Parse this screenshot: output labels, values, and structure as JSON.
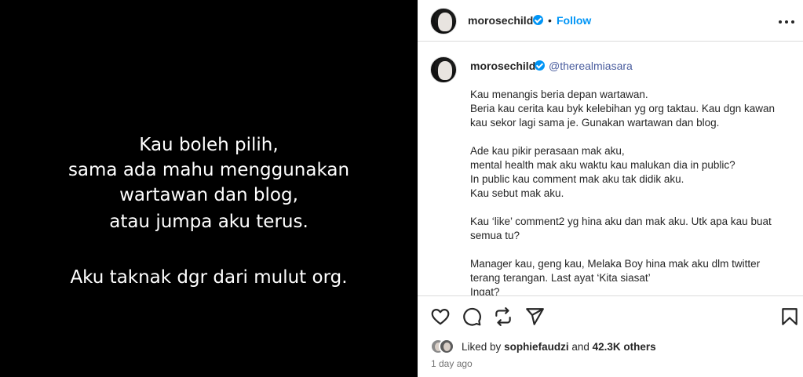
{
  "media": {
    "lines": [
      "Kau boleh pilih,",
      "sama ada mahu menggunakan",
      "wartawan dan blog,",
      "atau jumpa aku terus.",
      "Aku taknak dgr dari mulut org."
    ]
  },
  "header": {
    "username": "morosechild",
    "separator": "•",
    "follow_label": "Follow"
  },
  "caption": {
    "username": "morosechild",
    "mention": "@therealmiasara",
    "paragraphs": [
      "Kau menangis beria depan wartawan.\nBeria kau cerita kau byk kelebihan yg org taktau. Kau dgn kawan kau sekor lagi sama je. Gunakan wartawan dan blog.",
      "Ade kau pikir perasaan mak aku,\nmental health mak aku waktu kau malukan dia in public?\nIn public kau comment mak aku tak didik aku.\nKau sebut mak aku.",
      "Kau ‘like’ comment2 yg hina aku dan mak aku. Utk apa kau buat semua tu?",
      "Manager kau, geng kau, Melaka Boy hina mak aku dlm twitter terang terangan. Last ayat ‘Kita siasat’\nIngat?"
    ]
  },
  "likes": {
    "prefix": "Liked by",
    "user": "sophiefaudzi",
    "middle": "and",
    "others": "42.3K others"
  },
  "timestamp": "1 day ago",
  "icons": [
    "more-icon",
    "heart-icon",
    "comment-icon",
    "repost-icon",
    "send-icon",
    "bookmark-icon",
    "verified-icon"
  ],
  "colors": {
    "accent": "#0095f6",
    "mention": "#4a5d9e",
    "media_bg": "#000000"
  }
}
